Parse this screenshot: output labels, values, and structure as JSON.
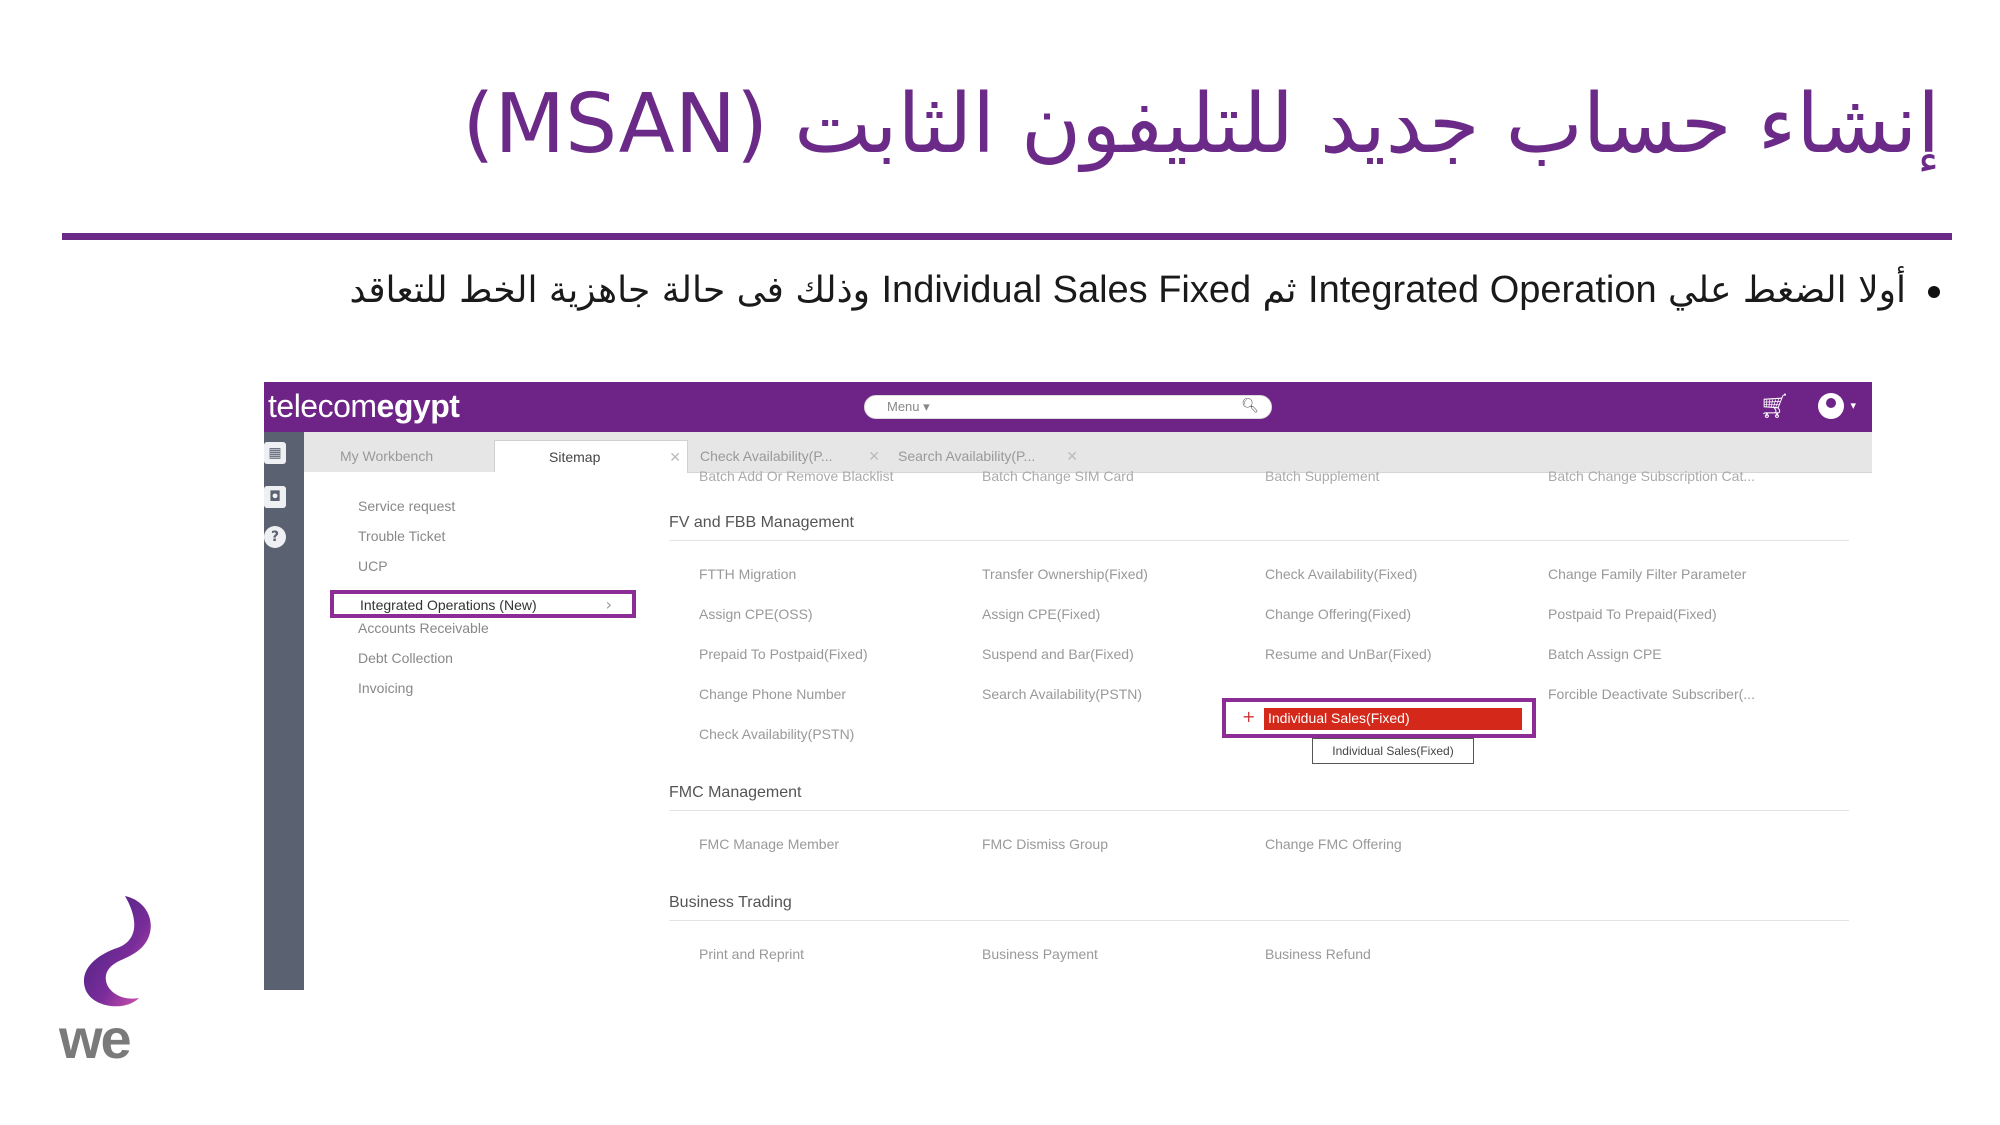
{
  "slide": {
    "title": "إنشاء حساب جديد للتليفون الثابت (MSAN)",
    "bullet": {
      "part1": "أولا الضغط علي ",
      "en1": "Integrated Operation",
      "part2": " ثم ",
      "en2": "Individual Sales Fixed",
      "part3": " وذلك فى حالة جاهزية الخط للتعاقد"
    },
    "accent_color": "#6b2a88"
  },
  "app": {
    "logo_light": "telecom",
    "logo_bold": "egypt",
    "menu_label": "Menu ▾",
    "tabs": [
      {
        "label": "My Workbench"
      },
      {
        "label": "Sitemap"
      },
      {
        "label": "Check Availability(P..."
      },
      {
        "label": "Search Availability(P..."
      }
    ],
    "sidebar": [
      "Service request",
      "Trouble Ticket",
      "UCP",
      "Integrated Operations (New)",
      "Accounts Receivable",
      "Debt Collection",
      "Invoicing"
    ],
    "cutoff_row": [
      "Batch Add Or Remove Blacklist",
      "Batch Change SIM Card",
      "Batch Supplement",
      "Batch Change Subscription Cat..."
    ],
    "sections": [
      {
        "title": "FV and FBB Management",
        "rows": [
          [
            "FTTH Migration",
            "Transfer Ownership(Fixed)",
            "Check Availability(Fixed)",
            "Change Family Filter Parameter"
          ],
          [
            "Assign CPE(OSS)",
            "Assign CPE(Fixed)",
            "Change Offering(Fixed)",
            "Postpaid To Prepaid(Fixed)"
          ],
          [
            "Prepaid To Postpaid(Fixed)",
            "Suspend and Bar(Fixed)",
            "Resume and UnBar(Fixed)",
            "Batch Assign CPE"
          ],
          [
            "Change Phone Number",
            "Search Availability(PSTN)",
            "Individual Sales(Fixed)",
            "Forcible Deactivate Subscriber(..."
          ],
          [
            "Check Availability(PSTN)"
          ]
        ]
      },
      {
        "title": "FMC Management",
        "rows": [
          [
            "FMC Manage Member",
            "FMC Dismiss Group",
            "Change FMC Offering"
          ]
        ]
      },
      {
        "title": "Business Trading",
        "rows": [
          [
            "Print and Reprint",
            "Business Payment",
            "Business Refund"
          ]
        ]
      }
    ],
    "tooltip": "Individual Sales(Fixed)",
    "brand_color": "#6e2486",
    "highlight_color": "#d4281a"
  }
}
